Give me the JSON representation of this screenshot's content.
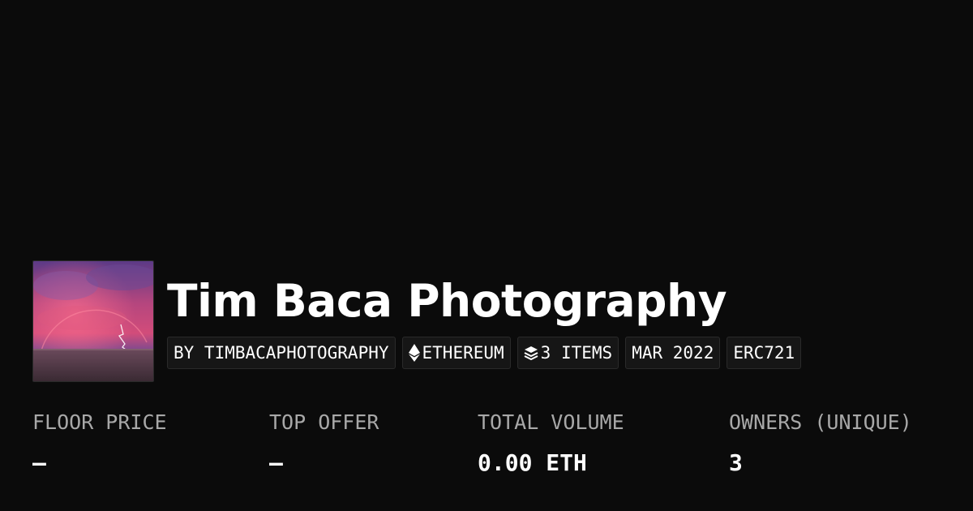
{
  "collection": {
    "title": "Tim Baca Photography",
    "avatar_alt": "Tim Baca Photography",
    "tags": {
      "creator": "BY TIMBACAPHOTOGRAPHY",
      "chain": "ETHEREUM",
      "chain_icon": "ethereum-icon",
      "items": "3 ITEMS",
      "items_icon": "layers-icon",
      "date": "MAR 2022",
      "standard": "ERC721"
    }
  },
  "stats": {
    "floor_price": {
      "label": "FLOOR PRICE",
      "value": "–"
    },
    "top_offer": {
      "label": "TOP OFFER",
      "value": "–"
    },
    "total_volume": {
      "label": "TOTAL VOLUME",
      "value": "0.00 ETH"
    },
    "owners": {
      "label": "OWNERS (UNIQUE)",
      "value": "3"
    }
  },
  "colors": {
    "background": "#0b0b0b",
    "tag_background": "#161616",
    "tag_border": "#2a2a2a",
    "label_text": "#a8a8a8",
    "value_text": "#ffffff"
  }
}
